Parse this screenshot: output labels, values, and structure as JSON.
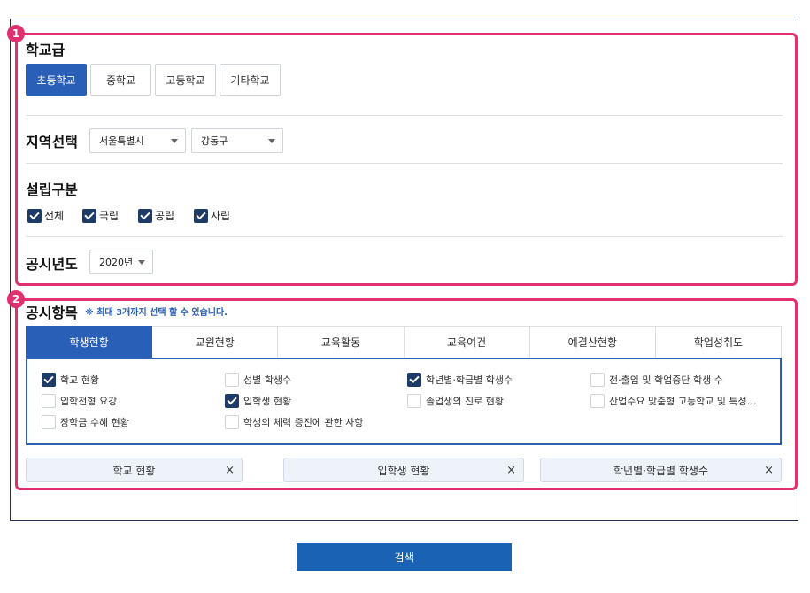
{
  "badges": [
    "1",
    "2"
  ],
  "school_level": {
    "title": "학교급",
    "options": [
      "초등학교",
      "중학교",
      "고등학교",
      "기타학교"
    ],
    "selected": "초등학교"
  },
  "region": {
    "title": "지역선택",
    "city": "서울특별시",
    "district": "강동구"
  },
  "establishment": {
    "title": "설립구분",
    "options": [
      {
        "label": "전체",
        "checked": true
      },
      {
        "label": "국립",
        "checked": true
      },
      {
        "label": "공립",
        "checked": true
      },
      {
        "label": "사립",
        "checked": true
      }
    ]
  },
  "year": {
    "title": "공시년도",
    "value": "2020년"
  },
  "items_section": {
    "title": "공시항목",
    "note": "※ 최대 3개까지 선택 할 수 있습니다.",
    "tabs": [
      "학생현황",
      "교원현황",
      "교육활동",
      "교육여건",
      "예결산현황",
      "학업성취도"
    ],
    "active_tab": "학생현황",
    "items": [
      {
        "label": "학교 현황",
        "checked": true
      },
      {
        "label": "성별 학생수",
        "checked": false
      },
      {
        "label": "학년별·학급별 학생수",
        "checked": true
      },
      {
        "label": "전·출입 및 학업중단 학생 수",
        "checked": false
      },
      {
        "label": "입학전형 요강",
        "checked": false
      },
      {
        "label": "입학생 현황",
        "checked": true
      },
      {
        "label": "졸업생의 진로 현황",
        "checked": false
      },
      {
        "label": "산업수요 맞춤형 고등학교 및 특성…",
        "checked": false
      },
      {
        "label": "장학금 수혜 현황",
        "checked": false
      },
      {
        "label": "학생의 체력 증진에 관한 사항",
        "checked": false
      }
    ],
    "selected_chips": [
      "학교 현황",
      "입학생 현황",
      "학년별·학급별 학생수"
    ],
    "remove_symbol": "×"
  },
  "search_button": "검색",
  "colors": {
    "accent": "#2a5fb8",
    "highlight": "#e0306f",
    "checkbox": "#1e3a66",
    "search": "#1a62b3"
  }
}
